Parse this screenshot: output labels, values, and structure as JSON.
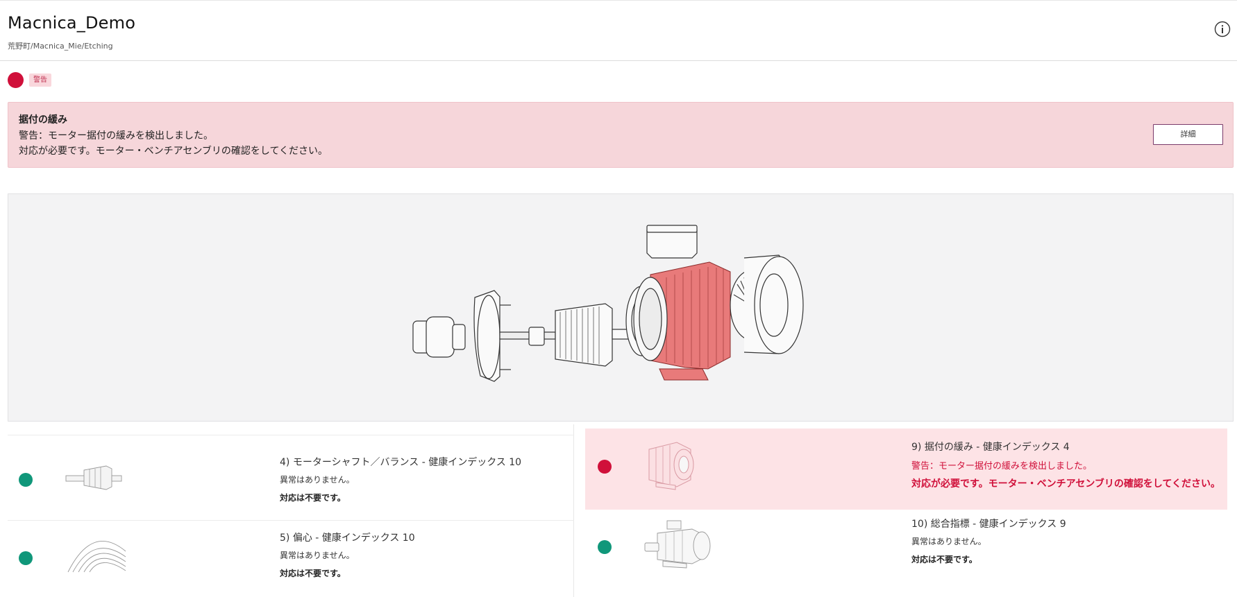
{
  "header": {
    "title": "Macnica_Demo",
    "breadcrumb": "荒野町/Macnica_Mie/Etching",
    "info_icon": "info-icon"
  },
  "status": {
    "badge": "警告",
    "color": "#d0103a"
  },
  "alert": {
    "title": "据付の緩み",
    "line1": "警告：モーター据付の緩みを検出しました。",
    "line2": "対応が必要です。モーター・ベンチアセンブリの確認をしてください。",
    "detail_button": "詳細"
  },
  "viewer": {
    "highlight_color": "#e87a7a"
  },
  "cards": {
    "left": [
      {
        "title": "4) モーターシャフト／バランス - 健康インデックス 10",
        "status": "異常はありません。",
        "action": "対応は不要です。",
        "dot": "green",
        "icon": "rotor-icon"
      },
      {
        "title": "5) 偏心 - 健康インデックス 10",
        "status": "異常はありません。",
        "action": "対応は不要です。",
        "dot": "green",
        "icon": "eccentric-icon"
      }
    ],
    "right": [
      {
        "title": "9) 据付の緩み - 健康インデックス 4",
        "status": "警告：モーター据付の緩みを検出しました。",
        "action": "対応が必要です。モーター・ベンチアセンブリの確認をしてください。",
        "dot": "red",
        "icon": "motor-housing-icon"
      },
      {
        "title": "10) 総合指標 - 健康インデックス 9",
        "status": "異常はありません。",
        "action": "対応は不要です。",
        "dot": "green",
        "icon": "motor-overall-icon"
      }
    ]
  }
}
